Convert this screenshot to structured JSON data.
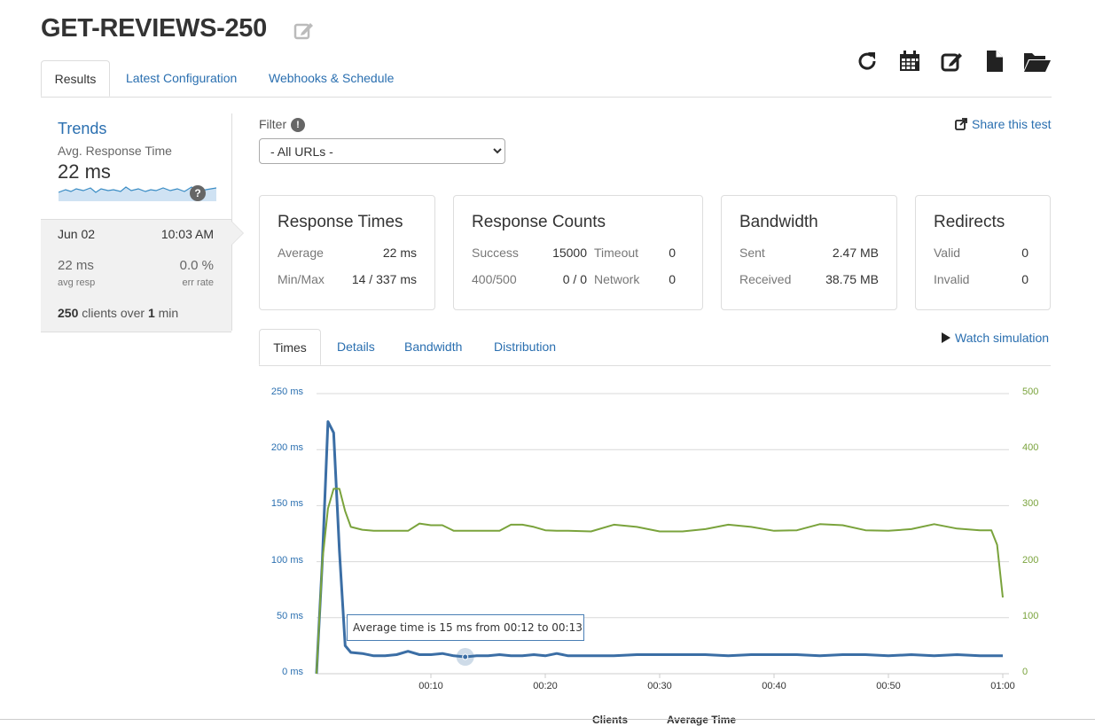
{
  "title": "GET-REVIEWS-250",
  "icons": {
    "edit_title": "edit-icon",
    "toolbar": [
      "refresh-icon",
      "calendar-icon",
      "edit-icon",
      "file-icon",
      "folder-open-icon"
    ]
  },
  "tabs": [
    {
      "label": "Results",
      "active": true
    },
    {
      "label": "Latest Configuration",
      "active": false
    },
    {
      "label": "Webhooks & Schedule",
      "active": false
    }
  ],
  "sidebar": {
    "trends_title": "Trends",
    "avg_label": "Avg. Response Time",
    "avg_value": "22 ms",
    "run": {
      "date": "Jun 02",
      "time": "10:03 AM",
      "avg_resp_value": "22 ms",
      "avg_resp_label": "avg resp",
      "err_rate_value": "0.0 %",
      "err_rate_label": "err rate",
      "clients": "250",
      "clients_mid": " clients over ",
      "duration": "1",
      "duration_unit": " min"
    }
  },
  "filter": {
    "label": "Filter",
    "selected": "- All URLs -"
  },
  "share_label": "Share this test",
  "cards": {
    "response_times": {
      "title": "Response Times",
      "average_label": "Average",
      "average_value": "22 ms",
      "minmax_label": "Min/Max",
      "minmax_value": "14 / 337 ms"
    },
    "response_counts": {
      "title": "Response Counts",
      "success_label": "Success",
      "success_value": "15000",
      "timeout_label": "Timeout",
      "timeout_value": "0",
      "errors_label": "400/500",
      "errors_value": "0 / 0",
      "network_label": "Network",
      "network_value": "0"
    },
    "bandwidth": {
      "title": "Bandwidth",
      "sent_label": "Sent",
      "sent_value": "2.47 MB",
      "received_label": "Received",
      "received_value": "38.75 MB"
    },
    "redirects": {
      "title": "Redirects",
      "valid_label": "Valid",
      "valid_value": "0",
      "invalid_label": "Invalid",
      "invalid_value": "0"
    }
  },
  "chart_tabs": [
    {
      "label": "Times",
      "active": true
    },
    {
      "label": "Details",
      "active": false
    },
    {
      "label": "Bandwidth",
      "active": false
    },
    {
      "label": "Distribution",
      "active": false
    }
  ],
  "watch_label": "Watch simulation",
  "tooltip": "Average time is 15 ms from 00:12 to 00:13",
  "legend_partial": [
    "Clients",
    "Average Time"
  ],
  "colors": {
    "link": "#2a6fb0",
    "avg_time": "#3b6ea5",
    "clients": "#7aa33c",
    "tooltip_border": "#4a7fb5"
  },
  "chart_data": {
    "type": "line",
    "x_ticks": [
      "00:10",
      "00:20",
      "00:30",
      "00:40",
      "00:50",
      "01:00"
    ],
    "y_left_ticks": [
      "0 ms",
      "50 ms",
      "100 ms",
      "150 ms",
      "200 ms",
      "250 ms"
    ],
    "y_right_ticks": [
      "0",
      "100",
      "200",
      "300",
      "400",
      "500"
    ],
    "x_range_seconds": [
      0,
      60
    ],
    "y_left_range": [
      0,
      250
    ],
    "y_right_range": [
      0,
      500
    ],
    "grid": true,
    "series": [
      {
        "name": "Average Time",
        "axis": "left",
        "x": [
          0,
          0.5,
          1,
          1.5,
          2,
          2.5,
          3,
          4,
          5,
          6,
          7,
          8,
          9,
          10,
          11,
          12,
          13,
          14,
          15,
          16,
          17,
          18,
          19,
          20,
          21,
          22,
          24,
          26,
          28,
          30,
          32,
          34,
          36,
          38,
          40,
          42,
          44,
          46,
          48,
          50,
          52,
          54,
          56,
          58,
          60
        ],
        "values": [
          0,
          100,
          225,
          215,
          110,
          25,
          19,
          18,
          16,
          16,
          17,
          20,
          17,
          17,
          18,
          16,
          15,
          16,
          16,
          17,
          16,
          16,
          17,
          16,
          18,
          16,
          16,
          16,
          17,
          17,
          17,
          17,
          16,
          17,
          17,
          17,
          16,
          17,
          17,
          16,
          17,
          16,
          17,
          16,
          16
        ]
      },
      {
        "name": "Clients",
        "axis": "right",
        "x": [
          0,
          0.5,
          1,
          1.5,
          2,
          2.5,
          3,
          4,
          5,
          6,
          7,
          8,
          9,
          10,
          11,
          12,
          13,
          14,
          15,
          16,
          17,
          18,
          19,
          20,
          21,
          22,
          24,
          26,
          28,
          30,
          32,
          34,
          36,
          38,
          40,
          42,
          44,
          46,
          48,
          50,
          52,
          54,
          56,
          58,
          59,
          59.5,
          60
        ],
        "values": [
          0,
          200,
          295,
          330,
          330,
          290,
          262,
          257,
          255,
          255,
          255,
          255,
          268,
          265,
          265,
          255,
          255,
          255,
          255,
          255,
          266,
          266,
          262,
          256,
          255,
          255,
          254,
          266,
          262,
          254,
          254,
          258,
          266,
          262,
          255,
          256,
          267,
          265,
          256,
          255,
          258,
          267,
          259,
          256,
          256,
          230,
          136
        ]
      }
    ]
  }
}
